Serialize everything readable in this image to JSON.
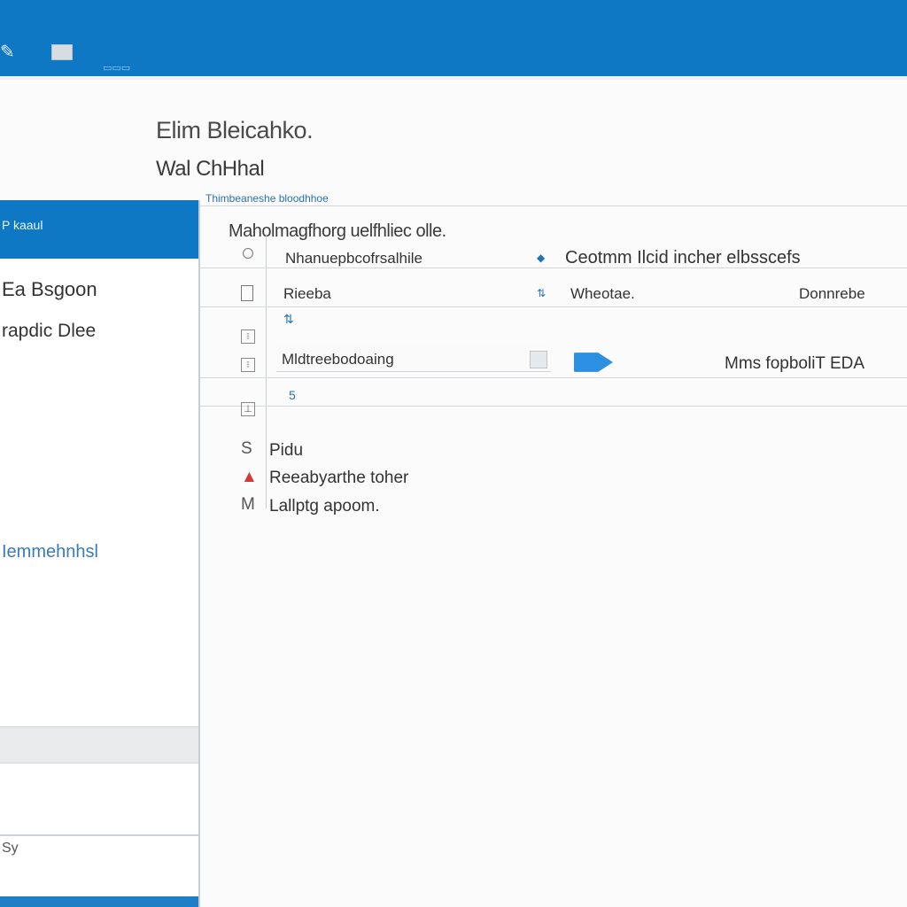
{
  "topbar": {
    "app_icon": "✎",
    "doc_icon": "document-icon",
    "subtitle": "▭▭▭"
  },
  "page": {
    "title": "Elim Bleicahko.",
    "subtitle": "Wal ChHhal"
  },
  "left_pane": {
    "header": "P kaaul",
    "item1": "Ea Bsgoon",
    "item2": "rapdic Dlee",
    "link": "Iemmehnhsl",
    "footer": "Sy"
  },
  "right_pane": {
    "breadcrumb": "Thimbeaneshe bloodhhoe",
    "section_title": "Maholmagfhorg uelfhliec olle.",
    "rows": [
      {
        "left": "Nhanuepbcofrsalhile",
        "right": "Ceotmm Ilcid incher elbsscefs",
        "icon": "shield-icon"
      },
      {
        "left": "Rieeba",
        "sort": "⇅",
        "mid": "Wheotae.",
        "right": "Donnrebe",
        "sub": "⇅"
      },
      {
        "dropdown_value": "Mldtreebodoaing",
        "right": "Mms fopboliT EDA",
        "sub": "5"
      }
    ],
    "list": [
      {
        "icon": "S",
        "label": "Pidu"
      },
      {
        "icon": "▲",
        "label": "Reeabyarthe toher"
      },
      {
        "icon": "M",
        "label": "Lallptg apoom."
      }
    ]
  },
  "colors": {
    "accent": "#0e78c4",
    "link": "#1e73be",
    "alert": "#d23a3a"
  }
}
